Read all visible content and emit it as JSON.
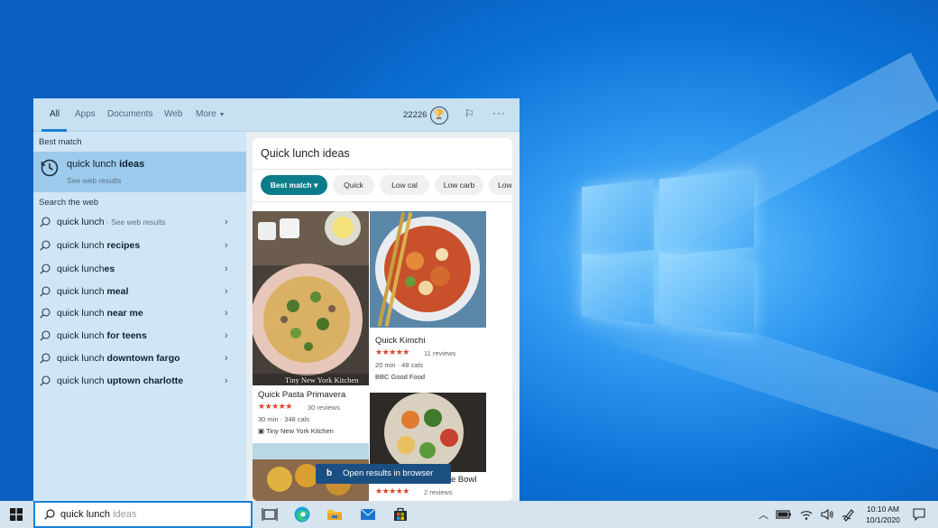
{
  "search_panel": {
    "tabs": [
      {
        "label": "All"
      },
      {
        "label": "Apps"
      },
      {
        "label": "Documents"
      },
      {
        "label": "Web"
      },
      {
        "label": "More"
      }
    ],
    "points": "22226",
    "best_match_header": "Best match",
    "best_match": {
      "prefix": "quick lunch ",
      "bold": "ideas",
      "subtitle": "See web results"
    },
    "search_web_header": "Search the web",
    "suggestions": [
      {
        "prefix": "quick lunch",
        "bold": "",
        "hint": " - See web results"
      },
      {
        "prefix": "quick lunch ",
        "bold": "recipes",
        "hint": ""
      },
      {
        "prefix": "quick lunch",
        "bold": "es",
        "hint": ""
      },
      {
        "prefix": "quick lunch ",
        "bold": "meal",
        "hint": ""
      },
      {
        "prefix": "quick lunch ",
        "bold": "near me",
        "hint": ""
      },
      {
        "prefix": "quick lunch ",
        "bold": "for teens",
        "hint": ""
      },
      {
        "prefix": "quick lunch ",
        "bold": "downtown fargo",
        "hint": ""
      },
      {
        "prefix": "quick lunch ",
        "bold": "uptown charlotte",
        "hint": ""
      }
    ]
  },
  "preview": {
    "title": "Quick lunch ideas",
    "chips": [
      {
        "label": "Best match ▾"
      },
      {
        "label": "Quick"
      },
      {
        "label": "Low cal"
      },
      {
        "label": "Low carb"
      },
      {
        "label": "Low"
      }
    ],
    "recipes": [
      {
        "name": "Quick Pasta Primavera",
        "stars": "★★★★★",
        "reviews": "30 reviews",
        "meta": "30 min · 348 cals",
        "source": "Tiny New York Kitchen",
        "watermark": "Tiny New York Kitchen"
      },
      {
        "name": "Quick Kimchi",
        "stars": "★★★★★",
        "reviews": "11 reviews",
        "meta": "20 min · 48 cals",
        "source": "BBC Good Food"
      },
      {
        "name": "Quick Quinoa Veggie Bowl",
        "stars": "★★★★★",
        "reviews": "2 reviews"
      }
    ],
    "open_browser": "Open results in browser"
  },
  "taskbar": {
    "search_typed": "quick lunch",
    "search_ghost": " ideas",
    "time": "10:10 AM",
    "date": "10/1/2020"
  },
  "colors": {
    "accent": "#1d7fd4",
    "chip_active": "#0d7c8a",
    "stars": "#d9472b"
  }
}
